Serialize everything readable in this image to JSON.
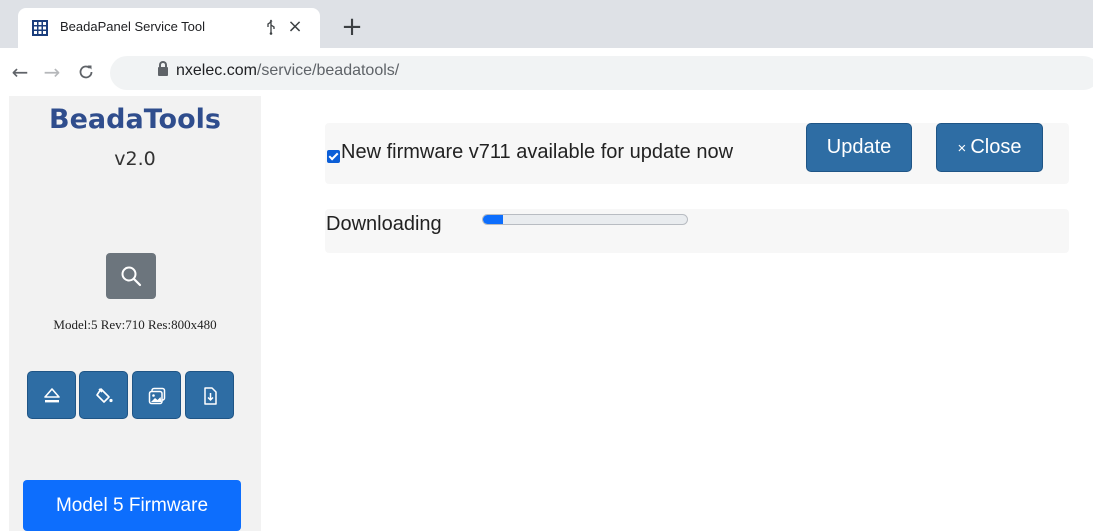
{
  "browser": {
    "tab_title": "BeadaPanel Service Tool",
    "tab_audio_icon": "usb-icon",
    "close_icon": "×",
    "new_tab_icon": "+",
    "url_host": "nxelec.com",
    "url_path": "/service/beadatools/"
  },
  "sidebar": {
    "brand": "BeadaTools",
    "version": "v2.0",
    "device_info": "Model:5 Rev:710 Res:800x480",
    "tools": [
      "eject-icon",
      "paint-bucket-icon",
      "image-icon",
      "download-file-icon"
    ],
    "firmware_button": "Model 5 Firmware"
  },
  "main": {
    "alert_text": "New firmware v711 available for update now",
    "alert_checked": true,
    "update_button": "Update",
    "close_button": "Close",
    "close_symbol": "×",
    "progress_label": "Downloading",
    "progress_fraction": 0.1
  },
  "colors": {
    "brand": "#2f4d8d",
    "button": "#2e6da4",
    "primary": "#0d6efd",
    "search_button": "#6c757d"
  }
}
